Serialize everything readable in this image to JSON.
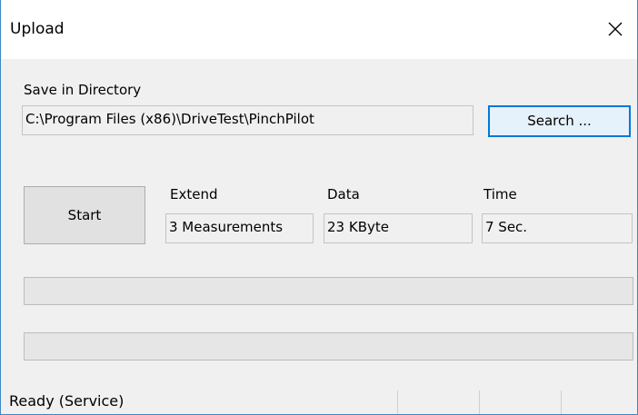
{
  "window": {
    "title": "Upload",
    "close_icon": "close-icon"
  },
  "directory": {
    "label": "Save in Directory",
    "value": "C:\\Program Files (x86)\\DriveTest\\PinchPilot",
    "search_label": "Search ..."
  },
  "actions": {
    "start_label": "Start"
  },
  "stats": {
    "extend_label": "Extend",
    "extend_value": "3 Measurements",
    "data_label": "Data",
    "data_value": "23 KByte",
    "time_label": "Time",
    "time_value": "7 Sec."
  },
  "progress": {
    "bar1_percent": 0,
    "bar2_percent": 0
  },
  "status": {
    "text": "Ready (Service)",
    "panel2": "",
    "panel3": "",
    "panel4": ""
  },
  "colors": {
    "accent": "#0078d7",
    "window_border": "#3c86c8",
    "progress_fill": "#06b025"
  }
}
